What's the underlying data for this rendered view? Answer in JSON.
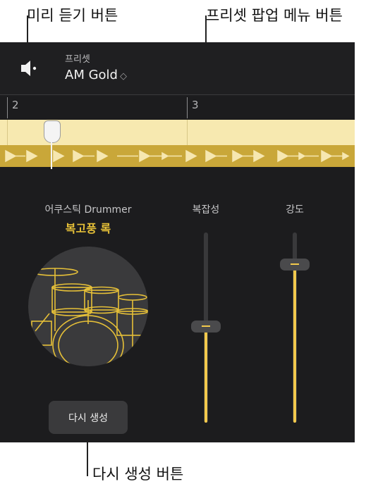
{
  "callouts": {
    "preview": "미리 듣기 버튼",
    "preset_popup": "프리셋 팝업 메뉴 버튼",
    "regenerate": "다시 생성 버튼"
  },
  "header": {
    "preset_label": "프리셋",
    "preset_value": "AM Gold",
    "preset_chevron": "◇"
  },
  "ruler": {
    "marks": [
      "2",
      "3"
    ]
  },
  "drummer": {
    "label": "어쿠스틱 Drummer",
    "style": "복고풍 록",
    "regenerate_label": "다시 생성"
  },
  "sliders": {
    "complexity": {
      "label": "복잡성",
      "value": 0.5
    },
    "loudness": {
      "label": "강도",
      "value": 0.84
    }
  },
  "colors": {
    "accent": "#f2c94c",
    "panel": "#1c1c1e",
    "region": "#c9a739"
  }
}
